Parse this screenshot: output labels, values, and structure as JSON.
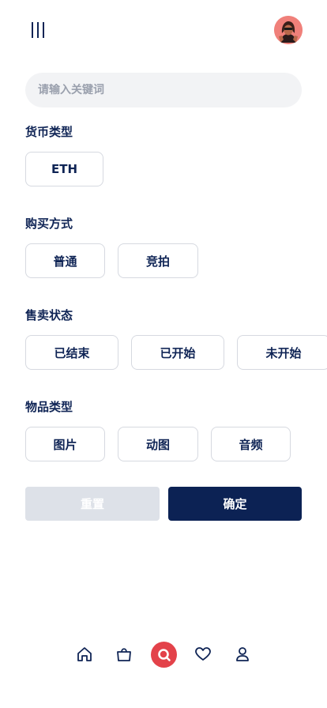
{
  "header": {
    "menu_icon": "menu-icon",
    "avatar_icon": "avatar"
  },
  "search": {
    "placeholder": "请输入关键词",
    "value": ""
  },
  "filters": {
    "currency": {
      "title": "货币类型",
      "options": [
        "ETH"
      ]
    },
    "purchase": {
      "title": "购买方式",
      "options": [
        "普通",
        "竞拍"
      ]
    },
    "status": {
      "title": "售卖状态",
      "options": [
        "已结束",
        "已开始",
        "未开始"
      ]
    },
    "item_type": {
      "title": "物品类型",
      "options": [
        "图片",
        "动图",
        "音频"
      ]
    }
  },
  "actions": {
    "reset_label": "重置",
    "confirm_label": "确定"
  },
  "bottom_nav": {
    "items": [
      "home-icon",
      "bag-icon",
      "search-icon",
      "heart-icon",
      "user-icon"
    ],
    "active": "search-icon"
  },
  "colors": {
    "primary": "#0c2254",
    "accent": "#e3424a",
    "chip_border": "#d6d9e0",
    "search_bg": "#f2f3f5",
    "reset_bg": "#dde1e8"
  }
}
